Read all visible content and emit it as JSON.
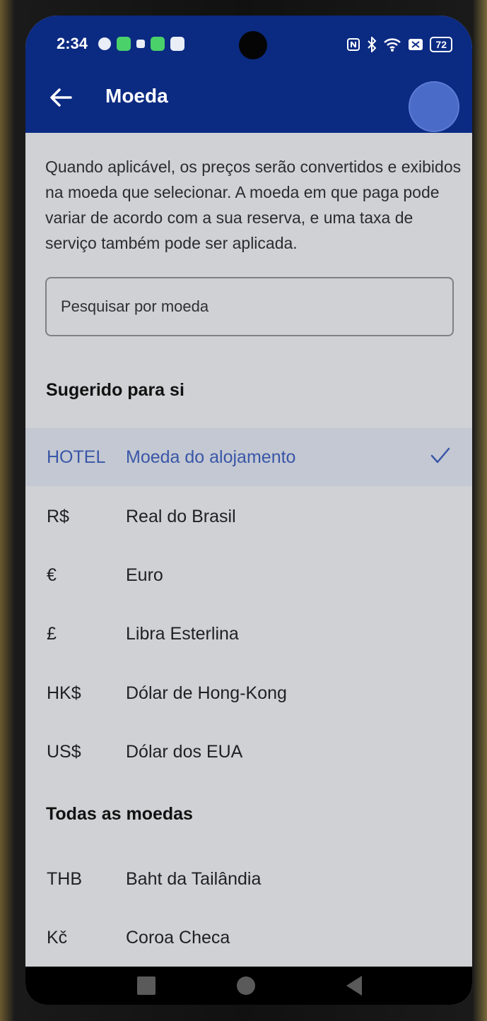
{
  "status_bar": {
    "time": "2:34",
    "battery": "72"
  },
  "app_bar": {
    "title": "Moeda"
  },
  "description": "Quando aplicável, os preços serão convertidos e exibidos na moeda que selecionar. A moeda em que paga pode variar de acordo com a sua reserva, e uma taxa de serviço também pode ser aplicada.",
  "search": {
    "placeholder": "Pesquisar por moeda",
    "value": ""
  },
  "suggested": {
    "header": "Sugerido para si",
    "items": [
      {
        "code": "HOTEL",
        "name": "Moeda do alojamento",
        "selected": true
      },
      {
        "code": "R$",
        "name": "Real do Brasil"
      },
      {
        "code": "€",
        "name": "Euro"
      },
      {
        "code": "£",
        "name": "Libra Esterlina"
      },
      {
        "code": "HK$",
        "name": "Dólar de Hong-Kong"
      },
      {
        "code": "US$",
        "name": "Dólar dos EUA"
      }
    ]
  },
  "all": {
    "header": "Todas as moedas",
    "items": [
      {
        "code": "THB",
        "name": "Baht da Tailândia"
      },
      {
        "code": "Kč",
        "name": "Coroa Checa"
      }
    ]
  },
  "colors": {
    "app_bar": "#0b2a82",
    "accent": "#3a56a8",
    "background": "#cfd1d4"
  }
}
